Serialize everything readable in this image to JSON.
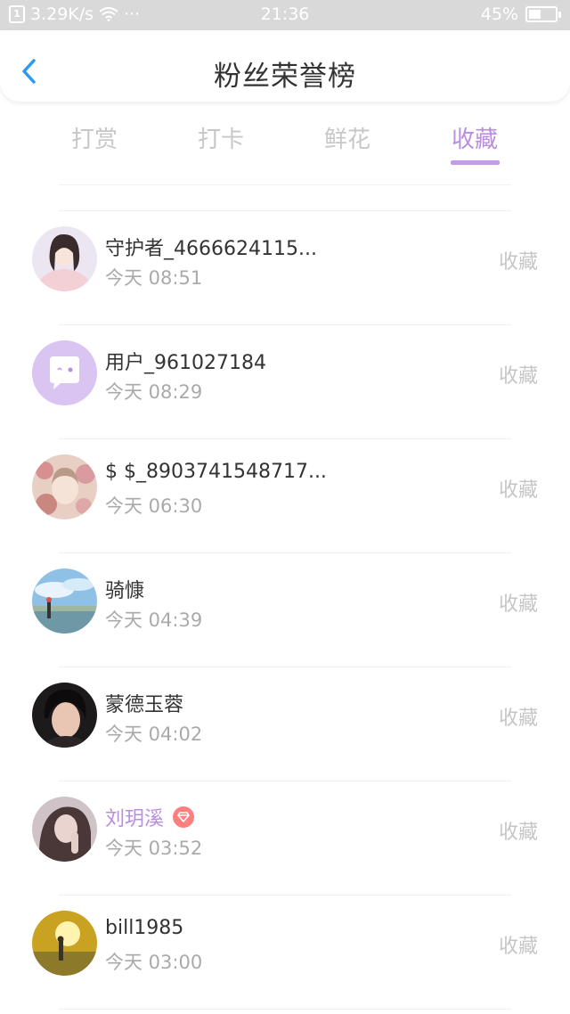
{
  "status_bar": {
    "net_speed": "3.29K/s",
    "wifi_icon": "wifi-icon",
    "more": "···",
    "time": "21:36",
    "battery_text": "45%",
    "battery_level": 0.45
  },
  "header": {
    "back_icon": "chevron-left-icon",
    "title": "粉丝荣誉榜"
  },
  "tabs": [
    {
      "label": "打赏",
      "active": false
    },
    {
      "label": "打卡",
      "active": false
    },
    {
      "label": "鲜花",
      "active": false
    },
    {
      "label": "收藏",
      "active": true
    }
  ],
  "colors": {
    "accent": "#b98ee0",
    "muted": "#c6c6c6",
    "vip_badge": "#ff7f7f"
  },
  "fans": [
    {
      "name": "守护者_4666624115...",
      "time": "今天 08:51",
      "action": "收藏",
      "vip": false
    },
    {
      "name": "用户_961027184",
      "time": "今天 08:29",
      "action": "收藏",
      "vip": false
    },
    {
      "name": "$ $_8903741548717...",
      "time": "今天 06:30",
      "action": "收藏",
      "vip": false
    },
    {
      "name": "骑慷",
      "time": "今天 04:39",
      "action": "收藏",
      "vip": false
    },
    {
      "name": "蒙德玉蓉",
      "time": "今天 04:02",
      "action": "收藏",
      "vip": false
    },
    {
      "name": "刘玥溪",
      "time": "今天 03:52",
      "action": "收藏",
      "vip": true
    },
    {
      "name": "bill1985",
      "time": "今天 03:00",
      "action": "收藏",
      "vip": false
    }
  ]
}
